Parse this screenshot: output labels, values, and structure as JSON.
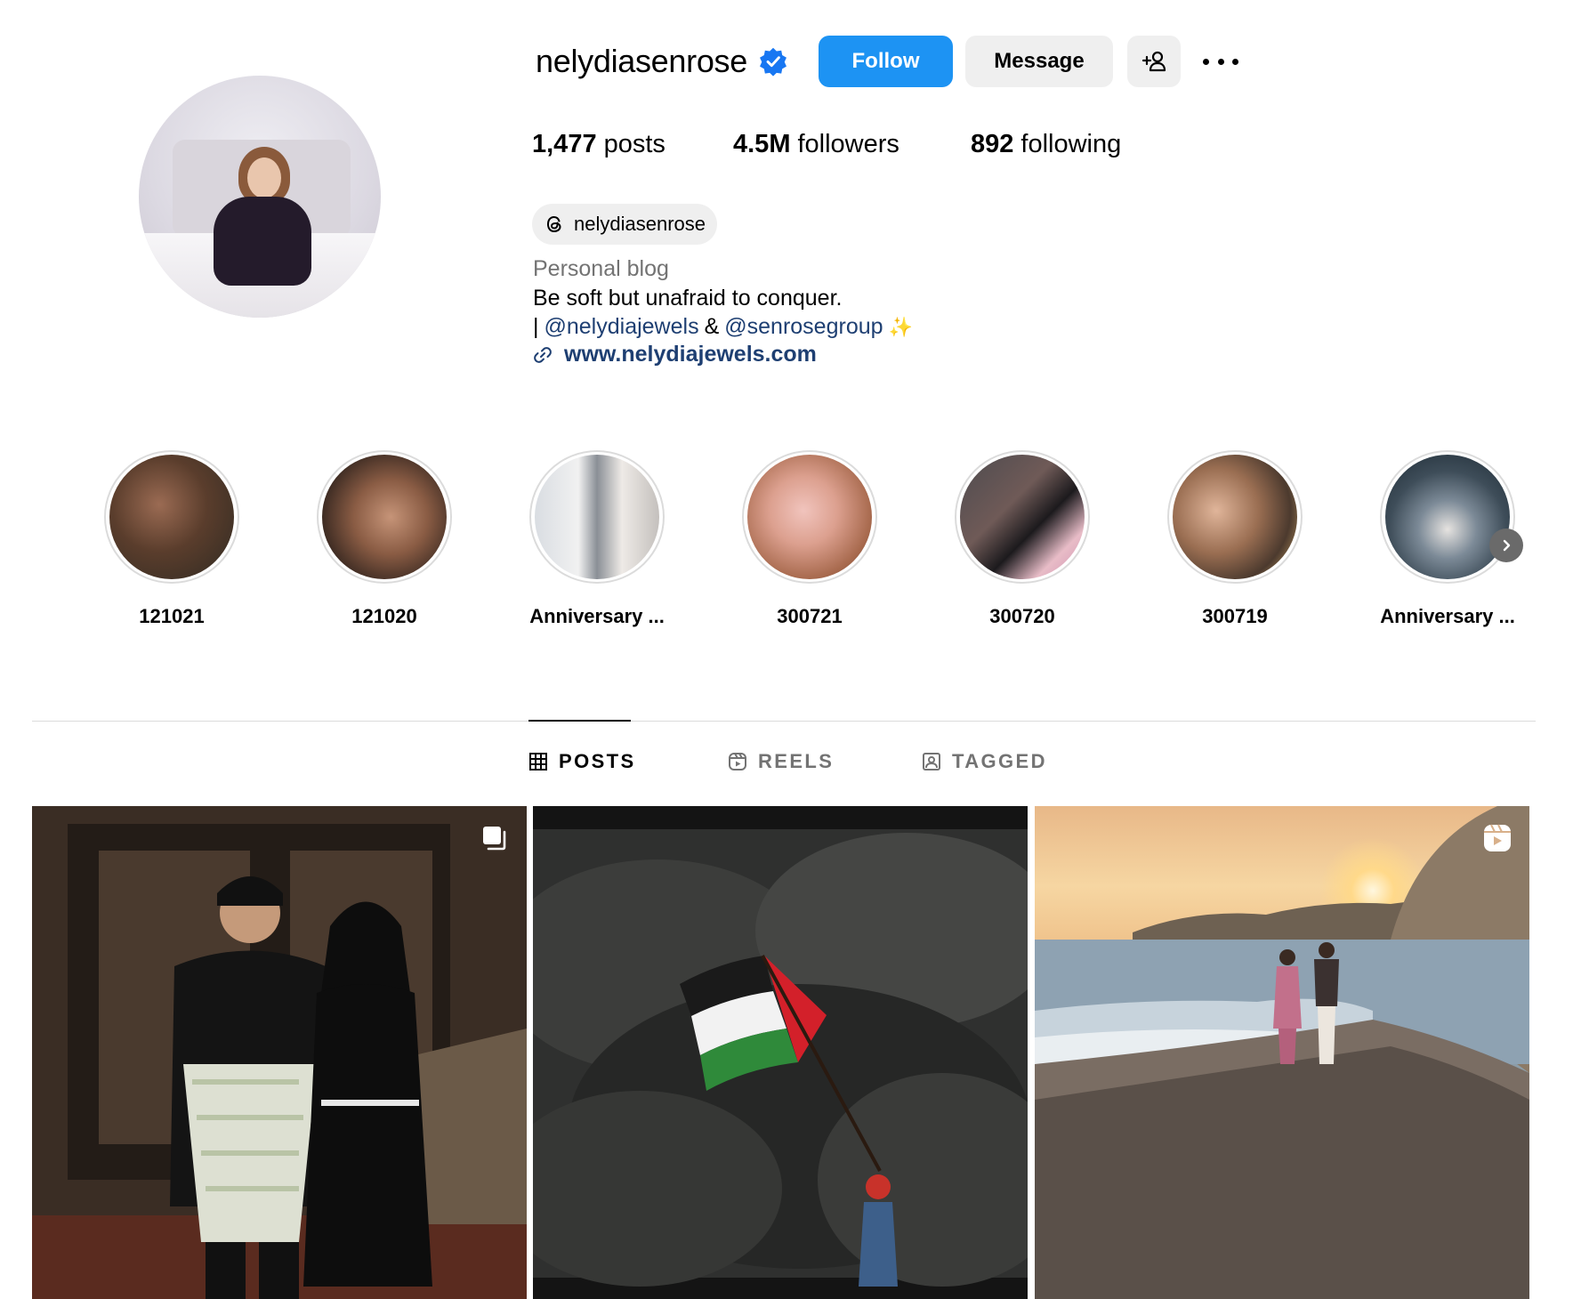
{
  "profile": {
    "username": "nelydiasenrose",
    "verified": true,
    "follow_label": "Follow",
    "message_label": "Message",
    "stats": {
      "posts_count": "1,477",
      "posts_label": "posts",
      "followers_count": "4.5M",
      "followers_label": "followers",
      "following_count": "892",
      "following_label": "following"
    },
    "threads_handle": "nelydiasenrose",
    "bio": {
      "category": "Personal blog",
      "line1": "Be soft but unafraid to conquer.",
      "separator": "|",
      "mention1": "@nelydiajewels",
      "ampersand": "&",
      "mention2": "@senrosegroup",
      "sparkle": "✨",
      "link": "www.nelydiajewels.com"
    }
  },
  "highlights": [
    {
      "label": "121021"
    },
    {
      "label": "121020"
    },
    {
      "label": "Anniversary ..."
    },
    {
      "label": "300721"
    },
    {
      "label": "300720"
    },
    {
      "label": "300719"
    },
    {
      "label": "Anniversary ..."
    }
  ],
  "tabs": {
    "posts": "POSTS",
    "reels": "REELS",
    "tagged": "TAGGED",
    "active": "posts"
  },
  "posts": [
    {
      "type": "carousel",
      "badge_icon": "carousel-icon"
    },
    {
      "type": "image"
    },
    {
      "type": "reel",
      "badge_icon": "reel-icon"
    }
  ],
  "colors": {
    "accent_blue": "#1d93f3",
    "link_blue": "#1e3f72",
    "secondary_text": "#737373",
    "button_gray": "#efefef",
    "verified_blue": "#1877f2"
  }
}
